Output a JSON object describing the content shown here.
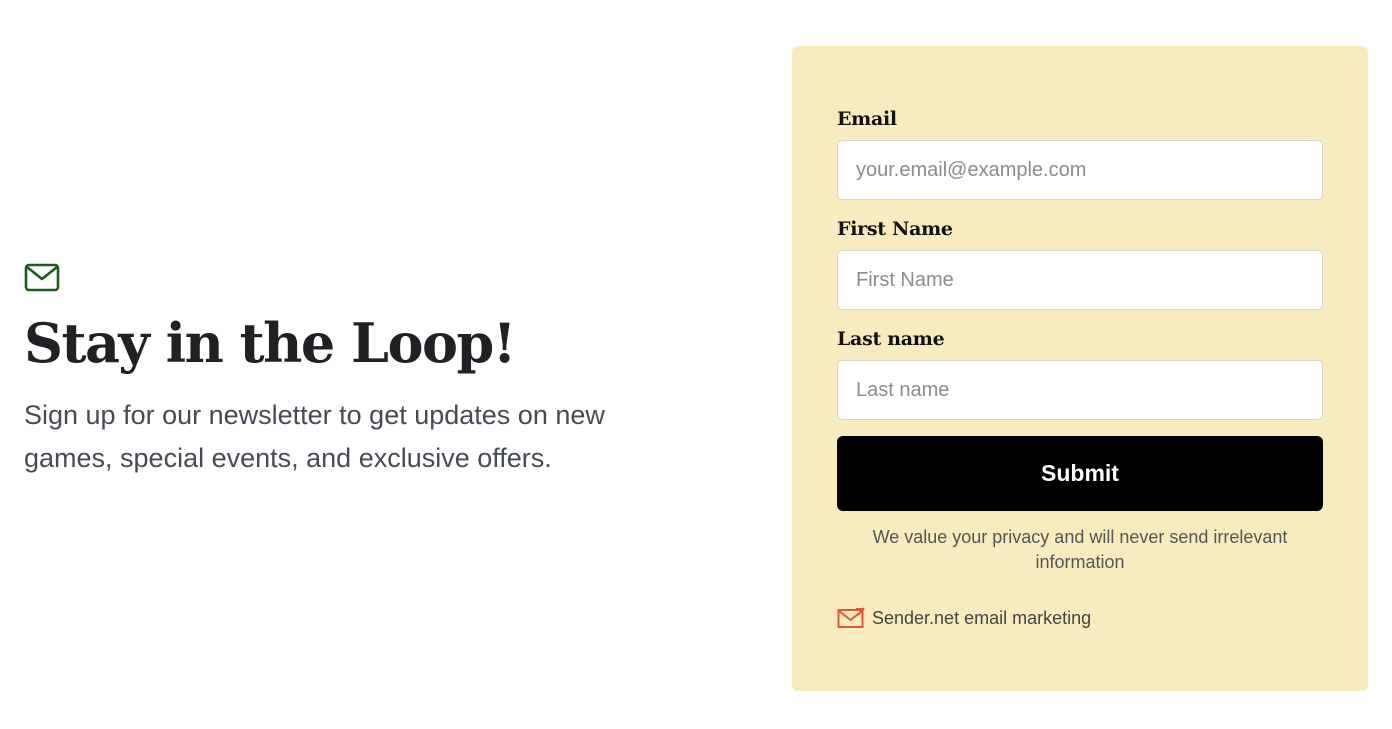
{
  "intro": {
    "icon": "envelope-icon",
    "icon_color": "#1e5a1e",
    "title": "Stay in the Loop!",
    "description": "Sign up for our newsletter to get updates on new games, special events, and exclusive offers."
  },
  "form": {
    "background": "#f8ebc0",
    "email": {
      "label": "Email",
      "placeholder": "your.email@example.com",
      "value": ""
    },
    "first_name": {
      "label": "First Name",
      "placeholder": "First Name",
      "value": ""
    },
    "last_name": {
      "label": "Last name",
      "placeholder": "Last name",
      "value": ""
    },
    "submit_label": "Submit",
    "privacy_text": "We value your privacy and will never send irrelevant information",
    "brand": {
      "icon": "sender-mail-icon",
      "icon_color": "#e0573a",
      "text": "Sender.net email marketing"
    }
  }
}
